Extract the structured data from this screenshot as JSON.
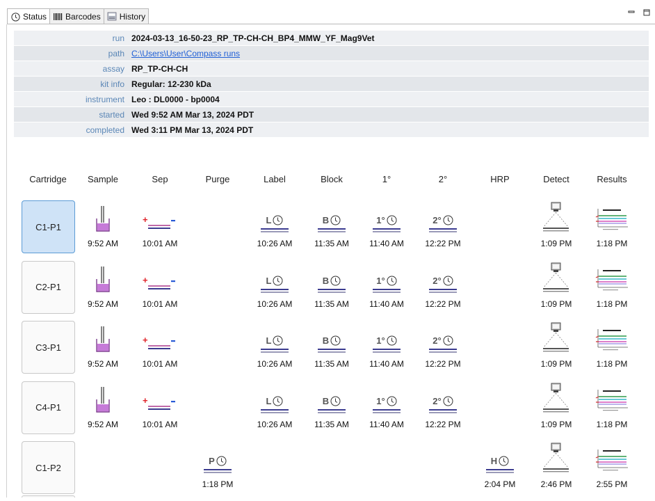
{
  "tabs": [
    {
      "label": "Status",
      "icon": "clock-icon",
      "active": true
    },
    {
      "label": "Barcodes",
      "icon": "barcode-icon",
      "active": false
    },
    {
      "label": "History",
      "icon": "history-icon",
      "active": false
    }
  ],
  "window_buttons": [
    "minimize-icon",
    "maximize-icon"
  ],
  "info": [
    {
      "label": "run",
      "value": "2024-03-13_16-50-23_RP_TP-CH-CH_BP4_MMW_YF_Mag9Vet",
      "link": false
    },
    {
      "label": "path",
      "value": "C:\\Users\\User\\Compass runs",
      "link": true
    },
    {
      "label": "assay",
      "value": "RP_TP-CH-CH",
      "link": false
    },
    {
      "label": "kit info",
      "value": "Regular: 12-230 kDa",
      "link": false
    },
    {
      "label": "instrument",
      "value": "Leo : DL0000 - bp0004",
      "link": false
    },
    {
      "label": "started",
      "value": "Wed 9:52 AM Mar 13, 2024 PDT",
      "link": false
    },
    {
      "label": "completed",
      "value": "Wed 3:11 PM Mar 13, 2024 PDT",
      "link": false
    }
  ],
  "columns": [
    "Cartridge",
    "Sample",
    "Sep",
    "Purge",
    "Label",
    "Block",
    "1°",
    "2°",
    "HRP",
    "Detect",
    "Results"
  ],
  "step_letters": {
    "Purge": "P",
    "Label": "L",
    "Block": "B",
    "1°": "1°",
    "2°": "2°",
    "HRP": "H"
  },
  "colors": {
    "selected_bg": "#cfe3f7",
    "label_color": "#5a86b6",
    "link_color": "#1f5fd6",
    "sample_fill": "#c67ad8",
    "sep_plus": "#e0242b",
    "sep_minus": "#2a5bd6",
    "bar_color": "#3b3b8f"
  },
  "rows": [
    {
      "cartridge": "C1-P1",
      "selected": true,
      "times": {
        "Sample": "9:52 AM",
        "Sep": "10:01 AM",
        "Purge": "",
        "Label": "10:26 AM",
        "Block": "11:35 AM",
        "1°": "11:40 AM",
        "2°": "12:22 PM",
        "HRP": "",
        "Detect": "1:09 PM",
        "Results": "1:18 PM"
      }
    },
    {
      "cartridge": "C2-P1",
      "selected": false,
      "times": {
        "Sample": "9:52 AM",
        "Sep": "10:01 AM",
        "Purge": "",
        "Label": "10:26 AM",
        "Block": "11:35 AM",
        "1°": "11:40 AM",
        "2°": "12:22 PM",
        "HRP": "",
        "Detect": "1:09 PM",
        "Results": "1:18 PM"
      }
    },
    {
      "cartridge": "C3-P1",
      "selected": false,
      "times": {
        "Sample": "9:52 AM",
        "Sep": "10:01 AM",
        "Purge": "",
        "Label": "10:26 AM",
        "Block": "11:35 AM",
        "1°": "11:40 AM",
        "2°": "12:22 PM",
        "HRP": "",
        "Detect": "1:09 PM",
        "Results": "1:18 PM"
      }
    },
    {
      "cartridge": "C4-P1",
      "selected": false,
      "times": {
        "Sample": "9:52 AM",
        "Sep": "10:01 AM",
        "Purge": "",
        "Label": "10:26 AM",
        "Block": "11:35 AM",
        "1°": "11:40 AM",
        "2°": "12:22 PM",
        "HRP": "",
        "Detect": "1:09 PM",
        "Results": "1:18 PM"
      }
    },
    {
      "cartridge": "C1-P2",
      "selected": false,
      "times": {
        "Sample": "",
        "Sep": "",
        "Purge": "1:18 PM",
        "Label": "",
        "Block": "",
        "1°": "",
        "2°": "",
        "HRP": "2:04 PM",
        "Detect": "2:46 PM",
        "Results": "2:55 PM"
      }
    }
  ]
}
